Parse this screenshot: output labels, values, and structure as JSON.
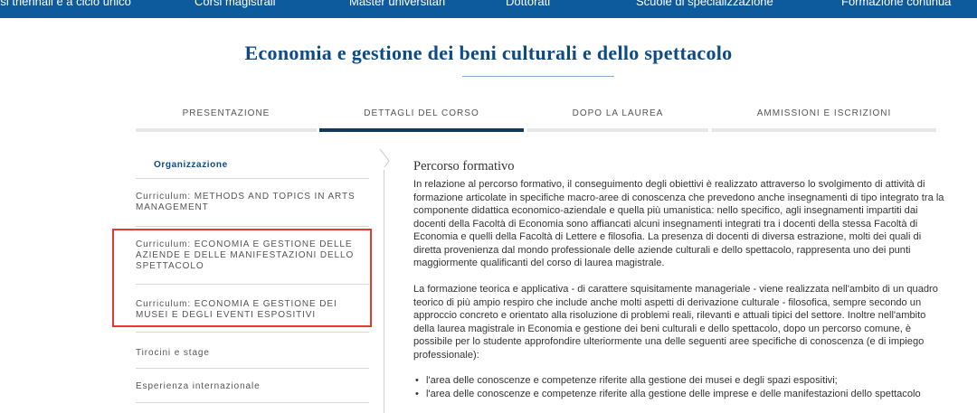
{
  "topnav": {
    "items": [
      "rsi triennali e a ciclo unico",
      "Corsi magistrali",
      "Master universitari",
      "Dottorati",
      "Scuole di specializzazione",
      "Formazione continua"
    ]
  },
  "page_title": "Economia e gestione dei beni culturali e dello spettacolo",
  "tabs": [
    {
      "label": "PRESENTAZIONE",
      "active": false
    },
    {
      "label": "DETTAGLI DEL CORSO",
      "active": true
    },
    {
      "label": "DOPO LA LAUREA",
      "active": false
    },
    {
      "label": "AMMISSIONI E ISCRIZIONI",
      "active": false
    }
  ],
  "sidebar": {
    "items": [
      {
        "label": "Organizzazione",
        "current": true
      },
      {
        "label": "Curriculum: METHODS AND TOPICS IN ARTS MANAGEMENT"
      },
      {
        "label": "Curriculum: ECONOMIA E GESTIONE DELLE AZIENDE E DELLE MANIFESTAZIONI DELLO SPETTACOLO"
      },
      {
        "label": "Curriculum: ECONOMIA E GESTIONE DEI MUSEI E DEGLI EVENTI ESPOSITIVI"
      },
      {
        "label": "Tirocini e stage"
      },
      {
        "label": "Esperienza internazionale"
      }
    ]
  },
  "content": {
    "section_title": "Percorso formativo",
    "paragraph1": "In relazione al percorso formativo, il conseguimento degli obiettivi è realizzato attraverso lo svolgimento di attività di formazione articolate in specifiche macro-aree di conoscenza che prevedono anche insegnamenti di tipo integrato tra la componente didattica economico-aziendale e quella più umanistica: nello specifico, agli insegnamenti impartiti dai docenti della Facoltà di Economia sono affiancati alcuni insegnamenti integrati tra i docenti della stessa Facoltà di Economia e quelli della Facoltà di Lettere e filosofia. La presenza di docenti di diversa estrazione, molti dei quali di diretta provenienza dal mondo professionale delle aziende culturali e dello spettacolo, rappresenta uno dei punti maggiormente qualificanti del corso di laurea magistrale.",
    "paragraph2": "La formazione teorica e applicativa - di carattere squisitamente manageriale - viene realizzata nell'ambito di un quadro teorico di più ampio respiro che include anche molti aspetti di derivazione culturale - filosofica, sempre secondo un approccio concreto e orientato alla risoluzione di problemi reali, rilevanti e attuali tipici del settore. Inoltre nell'ambito della laurea magistrale in Economia e gestione dei beni culturali e dello spettacolo, dopo un percorso comune, è possibile per lo studente approfondire ulteriormente una delle seguenti aree specifiche di conoscenza (e di impiego professionale):",
    "bullets": [
      "l'area delle conoscenze e competenze riferite alla gestione dei musei e degli spazi espositivi;",
      "l'area delle conoscenze e competenze riferite alla gestione delle imprese e delle manifestazioni dello spettacolo"
    ]
  },
  "colors": {
    "nav_bg": "#0d5a9c",
    "title": "#0d4a86",
    "active_tab_bar": "#12385e",
    "highlight": "#e53935"
  }
}
